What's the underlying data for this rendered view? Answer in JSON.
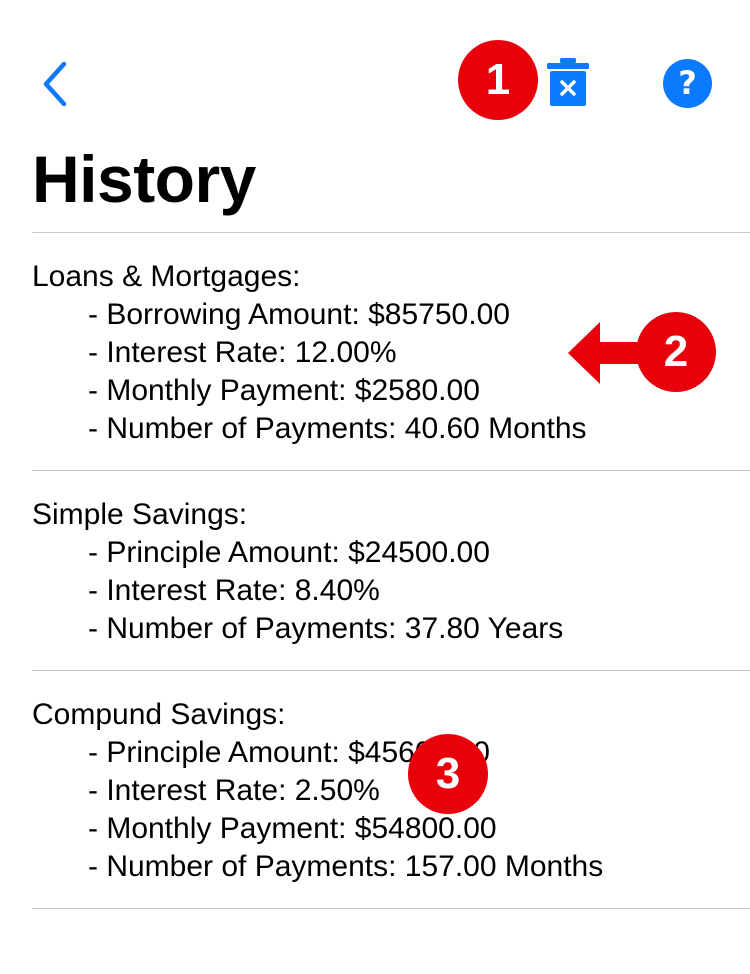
{
  "nav": {
    "back_icon": "chevron-left-icon",
    "trash_icon": "trash-x-icon",
    "help_label": "?",
    "accent_color": "#0a7aff"
  },
  "page": {
    "title": "History"
  },
  "history": {
    "entries": [
      {
        "title": "Loans & Mortgages:",
        "lines": [
          "- Borrowing Amount: $85750.00",
          "- Interest Rate: 12.00%",
          "- Monthly Payment: $2580.00",
          "- Number of Payments: 40.60 Months"
        ]
      },
      {
        "title": "Simple Savings:",
        "lines": [
          "- Principle Amount: $24500.00",
          "- Interest Rate: 8.40%",
          "- Number of Payments: 37.80 Years"
        ]
      },
      {
        "title": "Compund Savings:",
        "lines": [
          "- Principle Amount: $45609.00",
          "- Interest Rate: 2.50%",
          "- Monthly Payment: $54800.00",
          "- Number of Payments: 157.00 Months"
        ]
      }
    ]
  },
  "annotations": {
    "color": "#e8000b",
    "markers": [
      "1",
      "2",
      "3"
    ]
  }
}
